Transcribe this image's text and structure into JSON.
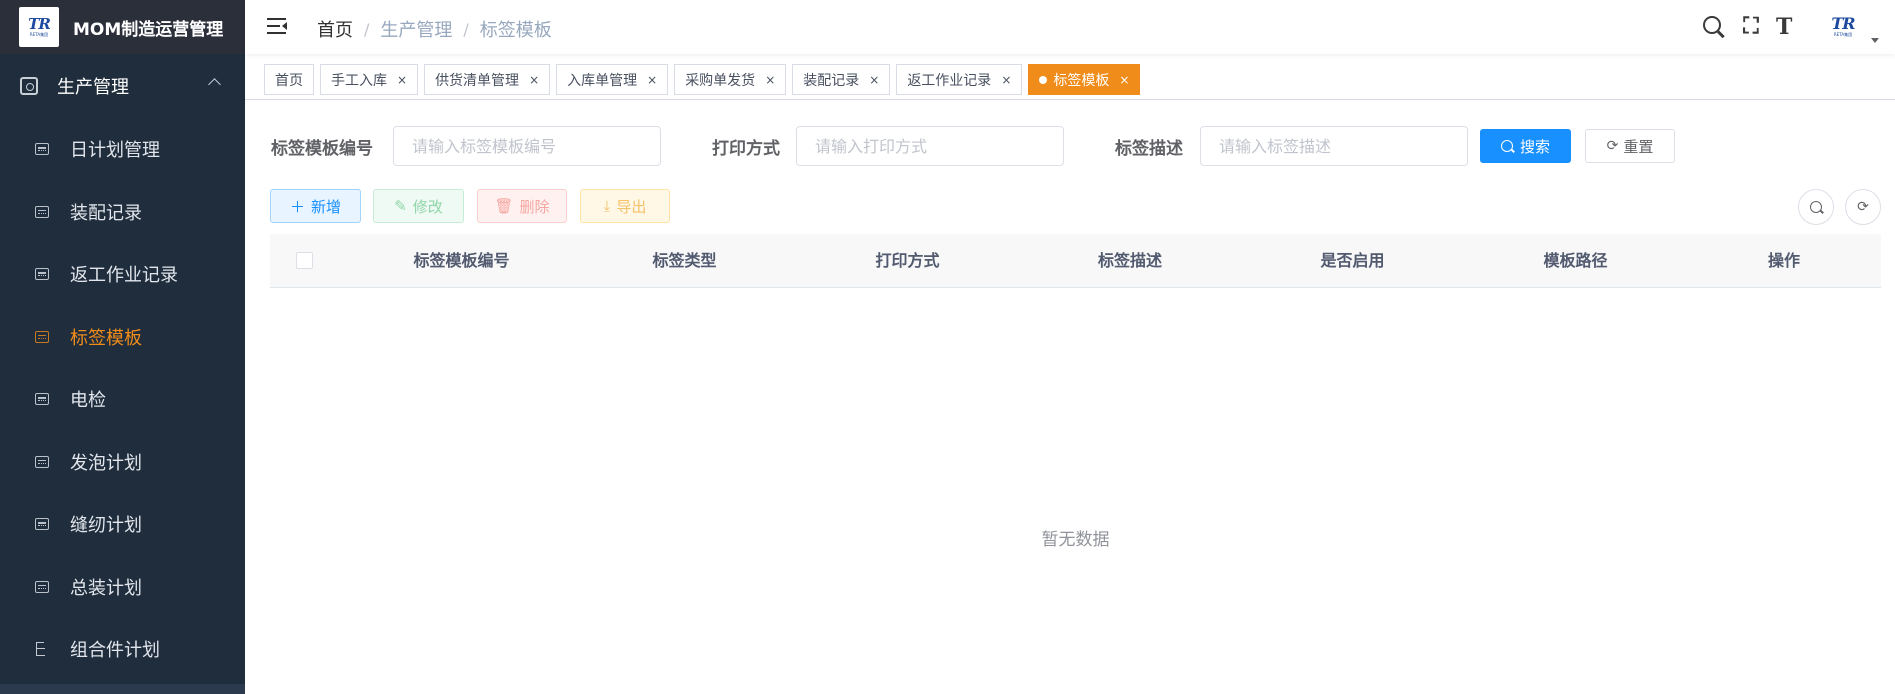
{
  "app": {
    "title": "MOM制造运营管理",
    "logo_text": "TR",
    "logo_sub": "RETA集团"
  },
  "sidebar": {
    "group": {
      "label": "生产管理",
      "icon": "module-icon",
      "expanded": true
    },
    "items": [
      {
        "label": "日计划管理",
        "icon": "calendar-icon",
        "active": false
      },
      {
        "label": "装配记录",
        "icon": "calendar-icon",
        "active": false
      },
      {
        "label": "返工作业记录",
        "icon": "calendar-icon",
        "active": false
      },
      {
        "label": "标签模板",
        "icon": "calendar-icon",
        "active": true
      },
      {
        "label": "电检",
        "icon": "calendar-icon",
        "active": false
      },
      {
        "label": "发泡计划",
        "icon": "calendar-icon",
        "active": false
      },
      {
        "label": "缝纫计划",
        "icon": "calendar-icon",
        "active": false
      },
      {
        "label": "总装计划",
        "icon": "calendar-icon",
        "active": false
      },
      {
        "label": "组合件计划",
        "icon": "tree-icon",
        "active": false
      }
    ],
    "colors": {
      "background": "#1f2d3d",
      "active": "#f08c1a"
    }
  },
  "header": {
    "breadcrumb": [
      "首页",
      "生产管理",
      "标签模板"
    ],
    "separator": "/"
  },
  "tags": [
    {
      "label": "首页",
      "closable": false,
      "active": false
    },
    {
      "label": "手工入库",
      "closable": true,
      "active": false
    },
    {
      "label": "供货清单管理",
      "closable": true,
      "active": false
    },
    {
      "label": "入库单管理",
      "closable": true,
      "active": false
    },
    {
      "label": "采购单发货",
      "closable": true,
      "active": false
    },
    {
      "label": "装配记录",
      "closable": true,
      "active": false
    },
    {
      "label": "返工作业记录",
      "closable": true,
      "active": false
    },
    {
      "label": "标签模板",
      "closable": true,
      "active": true
    }
  ],
  "close_glyph": "×",
  "search_form": {
    "code": {
      "label": "标签模板编号",
      "placeholder": "请输入标签模板编号",
      "value": ""
    },
    "print": {
      "label": "打印方式",
      "placeholder": "请输入打印方式",
      "value": ""
    },
    "desc": {
      "label": "标签描述",
      "placeholder": "请输入标签描述",
      "value": ""
    },
    "search_label": "搜索",
    "reset_label": "重置"
  },
  "toolbar": {
    "add_label": "新增",
    "edit_label": "修改",
    "delete_label": "删除",
    "export_label": "导出"
  },
  "table": {
    "columns": [
      "标签模板编号",
      "标签类型",
      "打印方式",
      "标签描述",
      "是否启用",
      "模板路径",
      "操作"
    ],
    "rows": [],
    "empty_text": "暂无数据"
  },
  "colors": {
    "primary": "#1890ff",
    "accent": "#f08c1a"
  }
}
